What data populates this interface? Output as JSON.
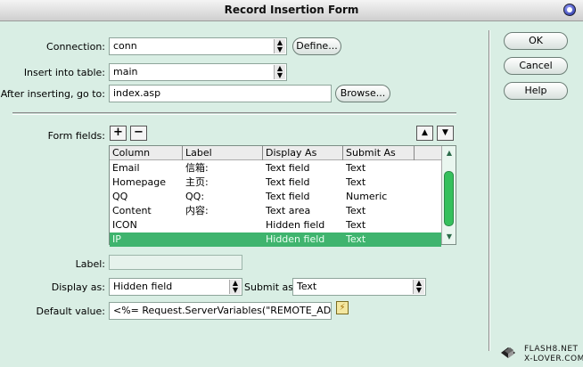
{
  "window": {
    "title": "Record Insertion Form"
  },
  "form": {
    "connection_label": "Connection:",
    "connection_value": "conn",
    "define_label": "Define...",
    "table_label": "Insert into table:",
    "table_value": "main",
    "after_label": "After inserting, go to:",
    "after_value": "index.asp",
    "browse_label": "Browse...",
    "fields_label": "Form fields:",
    "add_symbol": "+",
    "remove_symbol": "−",
    "up_symbol": "▲",
    "down_symbol": "▼",
    "label_label": "Label:",
    "label_value": "",
    "display_label": "Display as:",
    "display_value": "Hidden field",
    "submit_label": "Submit as:",
    "submit_value": "Text",
    "default_label": "Default value:",
    "default_value": "<%= Request.ServerVariables(\"REMOTE_ADDR\") %"
  },
  "table": {
    "headers": [
      "Column",
      "Label",
      "Display As",
      "Submit As"
    ],
    "rows": [
      {
        "column": "Email",
        "label": "信箱:",
        "display": "Text field",
        "submit": "Text"
      },
      {
        "column": "Homepage",
        "label": "主页:",
        "display": "Text field",
        "submit": "Text"
      },
      {
        "column": "QQ",
        "label": "QQ:",
        "display": "Text field",
        "submit": "Numeric"
      },
      {
        "column": "Content",
        "label": "内容:",
        "display": "Text area",
        "submit": "Text"
      },
      {
        "column": "ICON",
        "label": "",
        "display": "Hidden field",
        "submit": "Text"
      },
      {
        "column": "IP",
        "label": "",
        "display": "Hidden field",
        "submit": "Text"
      }
    ]
  },
  "buttons": {
    "ok": "OK",
    "cancel": "Cancel",
    "help": "Help"
  },
  "branding": {
    "line1": "FLASH8.NET",
    "line2": "X-LOVER.COM"
  },
  "colors": {
    "background": "#d9eee4",
    "selection": "#3fb46e",
    "scroll_thumb": "#35c05c"
  },
  "icons": [
    "close-icon",
    "plus-icon",
    "minus-icon",
    "move-up-icon",
    "move-down-icon",
    "dynamic-data-icon",
    "logo-icon"
  ]
}
